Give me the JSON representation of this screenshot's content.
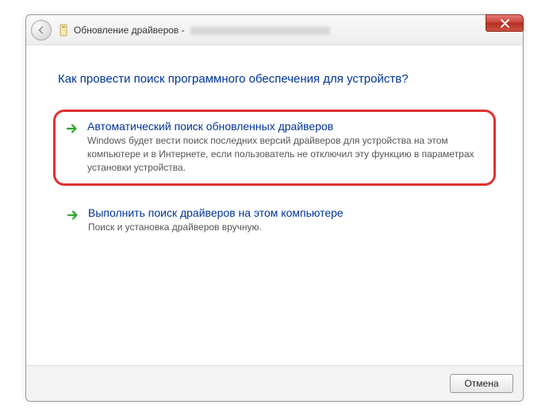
{
  "titlebar": {
    "title_prefix": "Обновление драйверов -"
  },
  "heading": "Как провести поиск программного обеспечения для устройств?",
  "options": {
    "auto": {
      "title": "Автоматический поиск обновленных драйверов",
      "desc": "Windows будет вести поиск последних версий драйверов для устройства на этом компьютере и в Интернете, если пользователь не отключил эту функцию в параметрах установки устройства."
    },
    "manual": {
      "title": "Выполнить поиск драйверов на этом компьютере",
      "desc": "Поиск и установка драйверов вручную."
    }
  },
  "footer": {
    "cancel": "Отмена"
  }
}
